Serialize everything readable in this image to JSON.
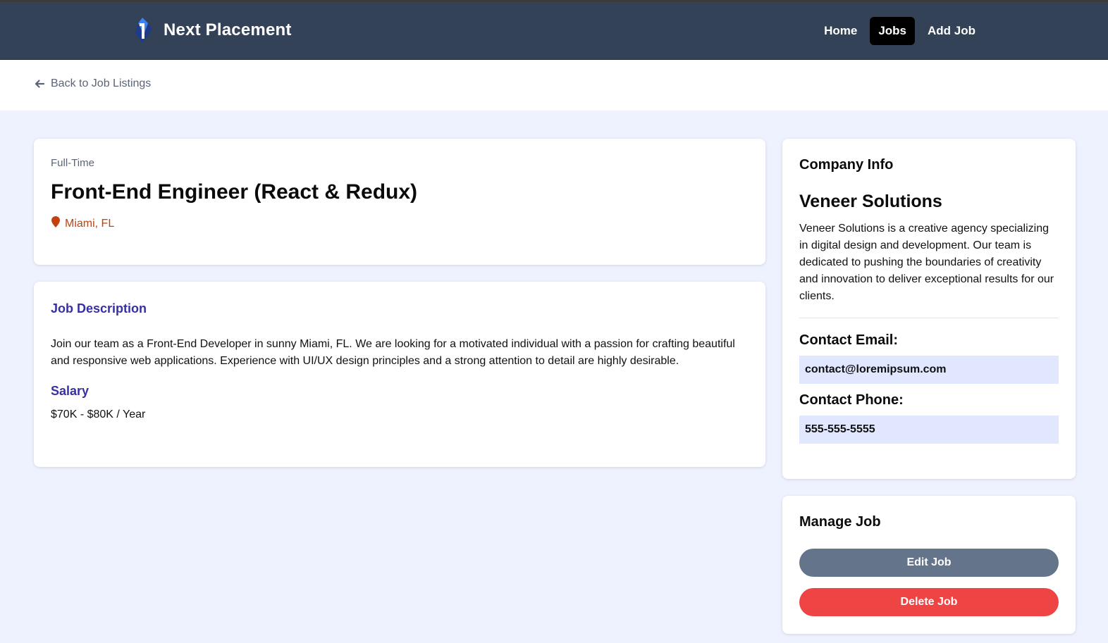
{
  "navbar": {
    "brand": "Next Placement",
    "links": [
      {
        "label": "Home",
        "active": false
      },
      {
        "label": "Jobs",
        "active": true
      },
      {
        "label": "Add Job",
        "active": false
      }
    ]
  },
  "back_link": "Back to Job Listings",
  "job": {
    "type": "Full-Time",
    "title": "Front-End Engineer (React & Redux)",
    "location": "Miami, FL",
    "description_heading": "Job Description",
    "description": "Join our team as a Front-End Developer in sunny Miami, FL. We are looking for a motivated individual with a passion for crafting beautiful and responsive web applications. Experience with UI/UX design principles and a strong attention to detail are highly desirable.",
    "salary_heading": "Salary",
    "salary": "$70K - $80K / Year"
  },
  "company": {
    "heading": "Company Info",
    "name": "Veneer Solutions",
    "description": "Veneer Solutions is a creative agency specializing in digital design and development. Our team is dedicated to pushing the boundaries of creativity and innovation to deliver exceptional results for our clients.",
    "email_label": "Contact Email:",
    "email": "contact@loremipsum.com",
    "phone_label": "Contact Phone:",
    "phone": "555-555-5555"
  },
  "manage": {
    "heading": "Manage Job",
    "edit_label": "Edit Job",
    "delete_label": "Delete Job"
  },
  "colors": {
    "navbar": "#334257",
    "accent": "#3730a3",
    "location": "#c2410c",
    "edit_button": "#64748b",
    "delete_button": "#ef4444",
    "contact_bg": "#e0e7ff",
    "page_bg": "#eef2fe"
  },
  "icons": {
    "logo": "brand-logo-icon",
    "back": "arrow-left-icon",
    "location": "map-pin-icon"
  }
}
